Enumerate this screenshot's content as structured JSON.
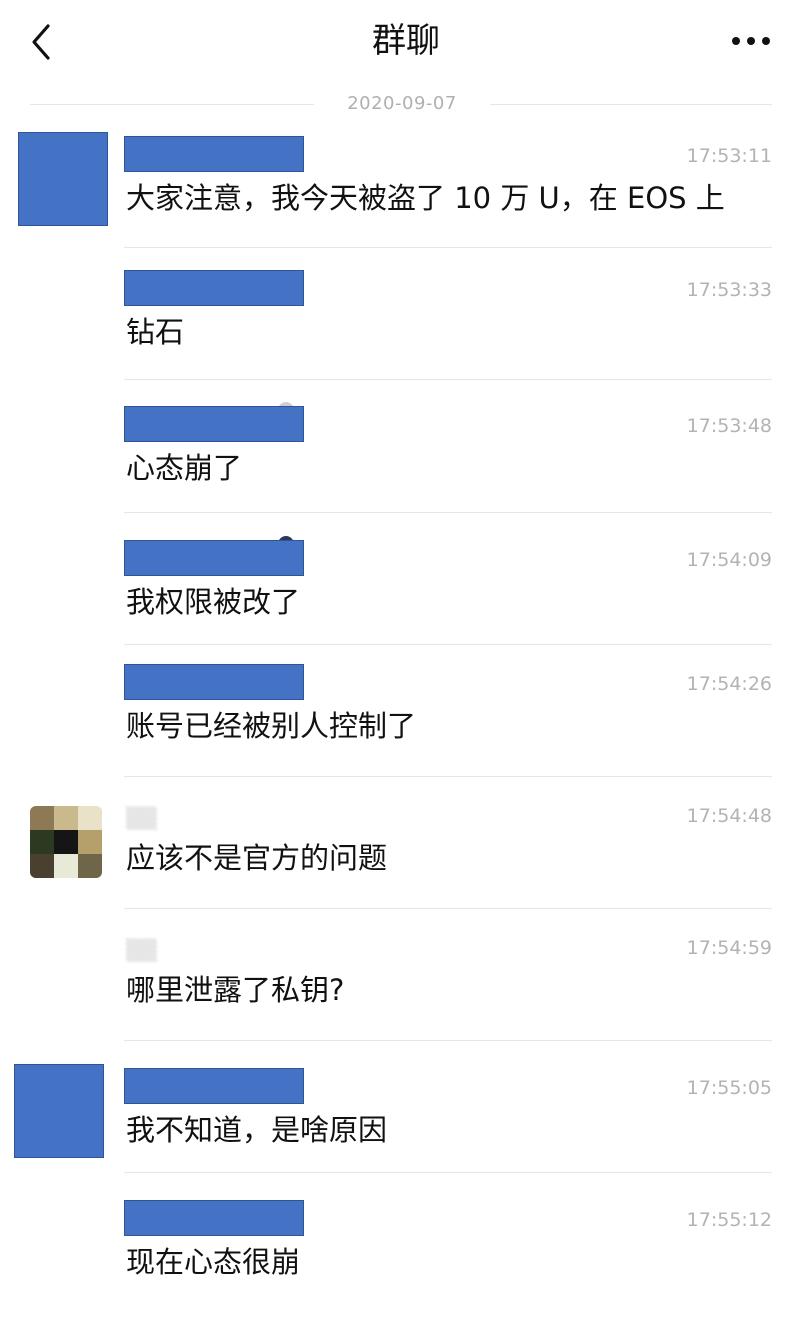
{
  "header": {
    "title": "群聊",
    "back_icon": "chevron-left-icon",
    "more_icon": "more-horizontal-icon"
  },
  "date_divider": "2020-09-07",
  "messages": [
    {
      "time": "17:53:11",
      "text": "大家注意，我今天被盗了 10 万 U，在 EOS 上",
      "avatar": "blue-redacted",
      "name": "redacted"
    },
    {
      "time": "17:53:33",
      "text": "钻石",
      "avatar": "none",
      "name": "redacted"
    },
    {
      "time": "17:53:48",
      "text": "心态崩了",
      "avatar": "none",
      "name": "redacted"
    },
    {
      "time": "17:54:09",
      "text": "我权限被改了",
      "avatar": "none",
      "name": "redacted"
    },
    {
      "time": "17:54:26",
      "text": "账号已经被别人控制了",
      "avatar": "none",
      "name": "redacted"
    },
    {
      "time": "17:54:48",
      "text": "应该不是官方的问题",
      "avatar": "pixelated-photo",
      "name": "blurred"
    },
    {
      "time": "17:54:59",
      "text": "哪里泄露了私钥?",
      "avatar": "none",
      "name": "blurred"
    },
    {
      "time": "17:55:05",
      "text": "我不知道，是啥原因",
      "avatar": "blue-redacted",
      "name": "redacted"
    },
    {
      "time": "17:55:12",
      "text": "现在心态很崩",
      "avatar": "none",
      "name": "redacted"
    }
  ],
  "colors": {
    "redaction_blue": "#4472c4",
    "timestamp_gray": "#b3b3b3",
    "separator": "#e6e6e6"
  }
}
